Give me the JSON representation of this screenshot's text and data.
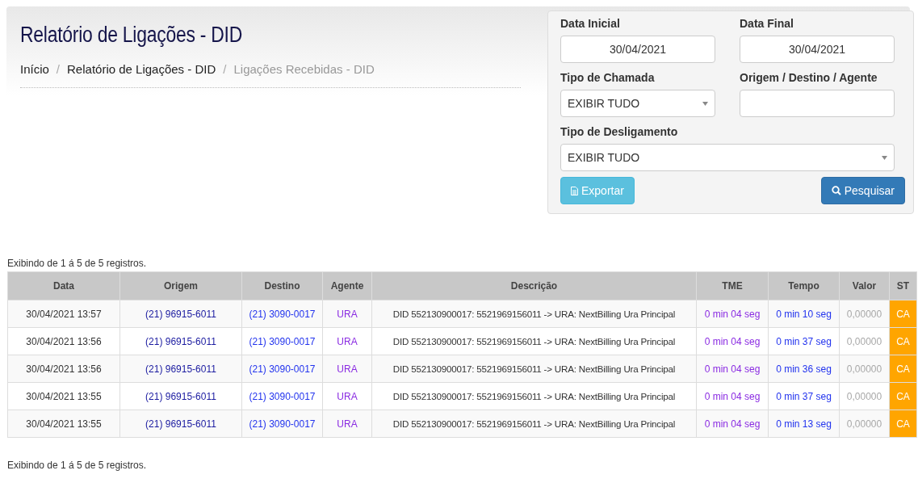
{
  "page_title": "Relatório de Ligações - DID",
  "breadcrumb_separator": "/",
  "breadcrumb": [
    {
      "label": "Início",
      "current": false
    },
    {
      "label": "Relatório de Ligações - DID",
      "current": false
    },
    {
      "label": "Ligações Recebidas - DID",
      "current": true
    }
  ],
  "filters": {
    "data_inicial": {
      "label": "Data Inicial",
      "value": "30/04/2021"
    },
    "data_final": {
      "label": "Data Final",
      "value": "30/04/2021"
    },
    "tipo_de_chamada": {
      "label": "Tipo de Chamada",
      "value": "EXIBIR TUDO"
    },
    "origem_destino_agente": {
      "label": "Origem / Destino / Agente"
    },
    "tipo_de_desligamento": {
      "label": "Tipo de Desligamento",
      "value": "EXIBIR TUDO"
    },
    "buttons": [
      {
        "kind": "export",
        "label": "Exportar"
      },
      {
        "kind": "search",
        "label": "Pesquisar"
      }
    ]
  },
  "summary_top": "Exibindo de 1 á 5 de 5 registros.",
  "table": {
    "columns": [
      "Data",
      "Origem",
      "Destino",
      "Agente",
      "Descrição",
      "TME",
      "Tempo",
      "Valor",
      "ST"
    ],
    "rows": [
      {
        "cells": [
          "30/04/2021 13:57",
          "(21) 96915-6011",
          "(21) 3090-0017",
          "URA",
          "DID 552130900017: 5521969156011 -> URA: NextBilling Ura Principal",
          "0 min 04 seg",
          "0 min 10 seg",
          "0,00000"
        ],
        "status": {
          "text": "CA",
          "color": "#ffa500"
        }
      },
      {
        "cells": [
          "30/04/2021 13:56",
          "(21) 96915-6011",
          "(21) 3090-0017",
          "URA",
          "DID 552130900017: 5521969156011 -> URA: NextBilling Ura Principal",
          "0 min 04 seg",
          "0 min 37 seg",
          "0,00000"
        ],
        "status": {
          "text": "CA",
          "color": "#ffa500"
        }
      },
      {
        "cells": [
          "30/04/2021 13:56",
          "(21) 96915-6011",
          "(21) 3090-0017",
          "URA",
          "DID 552130900017: 5521969156011 -> URA: NextBilling Ura Principal",
          "0 min 04 seg",
          "0 min 36 seg",
          "0,00000"
        ],
        "status": {
          "text": "CA",
          "color": "#ffa500"
        }
      },
      {
        "cells": [
          "30/04/2021 13:55",
          "(21) 96915-6011",
          "(21) 3090-0017",
          "URA",
          "DID 552130900017: 5521969156011 -> URA: NextBilling Ura Principal",
          "0 min 04 seg",
          "0 min 37 seg",
          "0,00000"
        ],
        "status": {
          "text": "CA",
          "color": "#ffa500"
        }
      },
      {
        "cells": [
          "30/04/2021 13:55",
          "(21) 96915-6011",
          "(21) 3090-0017",
          "URA",
          "DID 552130900017: 5521969156011 -> URA: NextBilling Ura Principal",
          "0 min 04 seg",
          "0 min 13 seg",
          "0,00000"
        ],
        "status": {
          "text": "CA",
          "color": "#ffa500"
        }
      }
    ]
  },
  "summary_bottom": "Exibindo de 1 á 5 de 5 registros."
}
